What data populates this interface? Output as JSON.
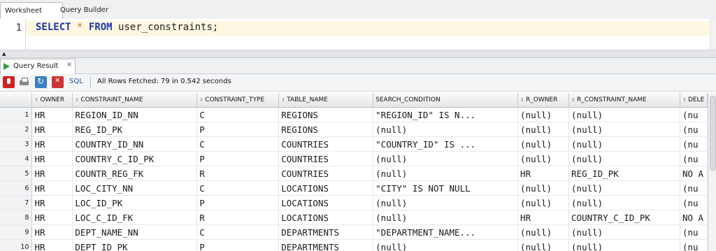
{
  "editor_tabs": [
    "Worksheet",
    "Query Builder"
  ],
  "editor": {
    "line_number": "1",
    "code": {
      "kw1": "SELECT",
      "star": "*",
      "kw2": "FROM",
      "table": "user_constraints;"
    }
  },
  "results_tab": {
    "label": "Query Result",
    "close": "×"
  },
  "toolbar": {
    "sql_label": "SQL",
    "status": "All Rows Fetched: 79 in 0.542 seconds"
  },
  "grid": {
    "columns": [
      "OWNER",
      "CONSTRAINT_NAME",
      "CONSTRAINT_TYPE",
      "TABLE_NAME",
      "SEARCH_CONDITION",
      "R_OWNER",
      "R_CONSTRAINT_NAME",
      "DELE"
    ],
    "rows": [
      [
        "1",
        "HR",
        "REGION_ID_NN",
        "C",
        "REGIONS",
        "\"REGION_ID\" IS N...",
        "(null)",
        "(null)",
        "(nu"
      ],
      [
        "2",
        "HR",
        "REG_ID_PK",
        "P",
        "REGIONS",
        "(null)",
        "(null)",
        "(null)",
        "(nu"
      ],
      [
        "3",
        "HR",
        "COUNTRY_ID_NN",
        "C",
        "COUNTRIES",
        "\"COUNTRY_ID\" IS ...",
        "(null)",
        "(null)",
        "(nu"
      ],
      [
        "4",
        "HR",
        "COUNTRY_C_ID_PK",
        "P",
        "COUNTRIES",
        "(null)",
        "(null)",
        "(null)",
        "(nu"
      ],
      [
        "5",
        "HR",
        "COUNTR_REG_FK",
        "R",
        "COUNTRIES",
        "(null)",
        "HR",
        "REG_ID_PK",
        "NO A"
      ],
      [
        "6",
        "HR",
        "LOC_CITY_NN",
        "C",
        "LOCATIONS",
        "\"CITY\" IS NOT NULL",
        "(null)",
        "(null)",
        "(nu"
      ],
      [
        "7",
        "HR",
        "LOC_ID_PK",
        "P",
        "LOCATIONS",
        "(null)",
        "(null)",
        "(null)",
        "(nu"
      ],
      [
        "8",
        "HR",
        "LOC_C_ID_FK",
        "R",
        "LOCATIONS",
        "(null)",
        "HR",
        "COUNTRY_C_ID_PK",
        "NO A"
      ],
      [
        "9",
        "HR",
        "DEPT_NAME_NN",
        "C",
        "DEPARTMENTS",
        "\"DEPARTMENT_NAME...",
        "(null)",
        "(null)",
        "(nu"
      ],
      [
        "10",
        "HR",
        "DEPT_ID_PK",
        "P",
        "DEPARTMENTS",
        "(null)",
        "(null)",
        "(null)",
        "(nu"
      ]
    ]
  }
}
